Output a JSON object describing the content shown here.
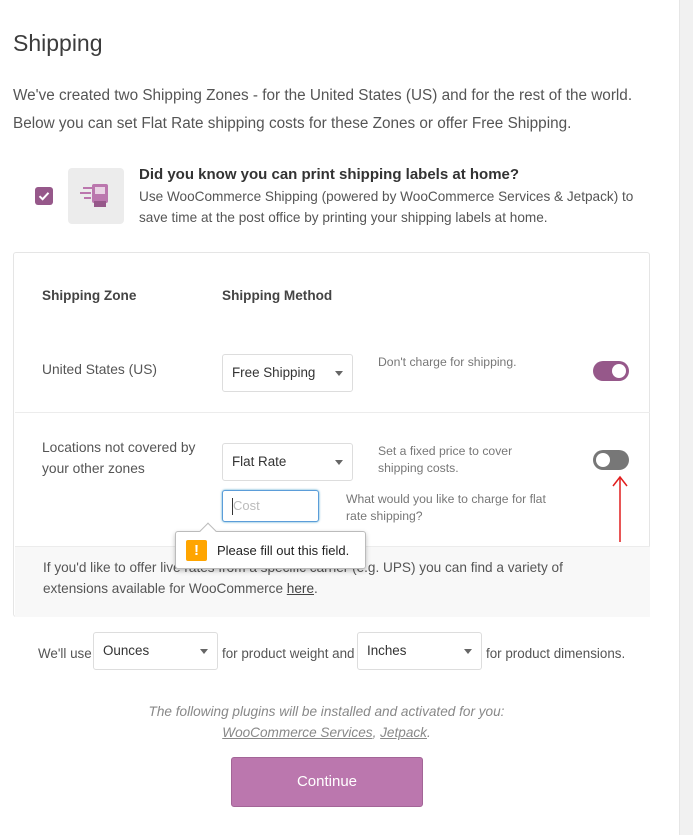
{
  "page": {
    "title": "Shipping",
    "intro": "We've created two Shipping Zones - for the United States (US) and for the rest of the world. Below you can set Flat Rate shipping costs for these Zones or offer Free Shipping."
  },
  "promo": {
    "checked": true,
    "title": "Did you know you can print shipping labels at home?",
    "description": "Use WooCommerce Shipping (powered by WooCommerce Services & Jetpack) to save time at the post office by printing your shipping labels at home.",
    "image_icon": "shipping-label-printer-icon"
  },
  "table": {
    "headers": {
      "zone": "Shipping Zone",
      "method": "Shipping Method"
    },
    "rows": [
      {
        "zone": "United States (US)",
        "method": "Free Shipping",
        "help": "Don't charge for shipping.",
        "enabled": true
      },
      {
        "zone": "Locations not covered by your other zones",
        "method": "Flat Rate",
        "help": "Set a fixed price to cover shipping costs.",
        "enabled": false,
        "cost_placeholder": "Cost",
        "cost_value": "",
        "cost_help": "What would you like to charge for flat rate shipping?"
      }
    ],
    "footer": {
      "text_before": "If you'd like to offer live rates from a specific carrier (e.g. UPS) you can find a variety of extensions available for WooCommerce",
      "link": "here",
      "text_after": "."
    }
  },
  "validation_tooltip": {
    "message": "Please fill out this field.",
    "icon": "warning-icon",
    "icon_glyph": "!"
  },
  "units": {
    "prefix": "We'll use",
    "weight": "Ounces",
    "middle": "for product weight and",
    "dimension": "Inches",
    "suffix": "for product dimensions."
  },
  "plugins": {
    "intro": "The following plugins will be installed and activated for you:",
    "list": [
      "WooCommerce Services",
      "Jetpack"
    ],
    "separator": ", ",
    "end": "."
  },
  "actions": {
    "continue": "Continue"
  },
  "colors": {
    "accent": "#96588a",
    "button": "#bb77ae",
    "toggle_off": "#777777",
    "warning": "#ffa500",
    "annotation_arrow": "#e11d1d"
  }
}
